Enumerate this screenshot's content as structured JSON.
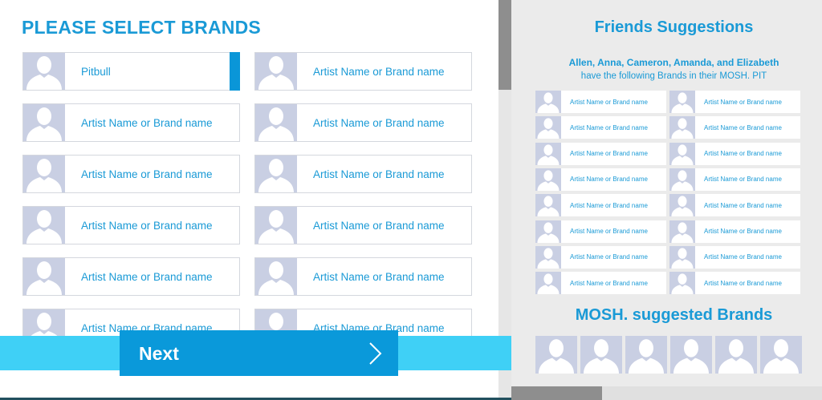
{
  "left": {
    "title": "PLEASE SELECT BRANDS",
    "brands": [
      {
        "label": "Pitbull",
        "selected": true
      },
      {
        "label": "Artist Name or Brand name",
        "selected": false
      },
      {
        "label": "Artist Name or Brand name",
        "selected": false
      },
      {
        "label": "Artist Name or Brand name",
        "selected": false
      },
      {
        "label": "Artist Name or Brand name",
        "selected": false
      },
      {
        "label": "Artist Name or Brand name",
        "selected": false
      },
      {
        "label": "Artist Name or Brand name",
        "selected": false
      },
      {
        "label": "Artist Name or Brand name",
        "selected": false
      },
      {
        "label": "Artist Name or Brand name",
        "selected": false
      },
      {
        "label": "Artist Name or Brand name",
        "selected": false
      },
      {
        "label": "Artist Name or Brand name",
        "selected": false
      },
      {
        "label": "Artist Name or Brand name",
        "selected": false
      }
    ],
    "next_label": "Next",
    "next_icon": "chevron-right-icon"
  },
  "right": {
    "title": "Friends Suggestions",
    "friends_line": "Allen, Anna, Cameron, Amanda, and Elizabeth",
    "friends_line2": "have the following Brands in their MOSH. PIT",
    "friend_brands": [
      "Artist Name or Brand name",
      "Artist Name or Brand name",
      "Artist Name or Brand name",
      "Artist Name or Brand name",
      "Artist Name or Brand name",
      "Artist Name or Brand name",
      "Artist Name or Brand name",
      "Artist Name or Brand name",
      "Artist Name or Brand name",
      "Artist Name or Brand name",
      "Artist Name or Brand name",
      "Artist Name or Brand name",
      "Artist Name or Brand name",
      "Artist Name or Brand name",
      "Artist Name or Brand name",
      "Artist Name or Brand name"
    ],
    "suggested_title": "MOSH. suggested Brands",
    "suggested_count": 6
  },
  "colors": {
    "accent": "#1a9ad6",
    "next_strip": "#3fd0f6",
    "avatar_bg": "#c9cfe3",
    "panel_bg": "#ebebeb"
  }
}
